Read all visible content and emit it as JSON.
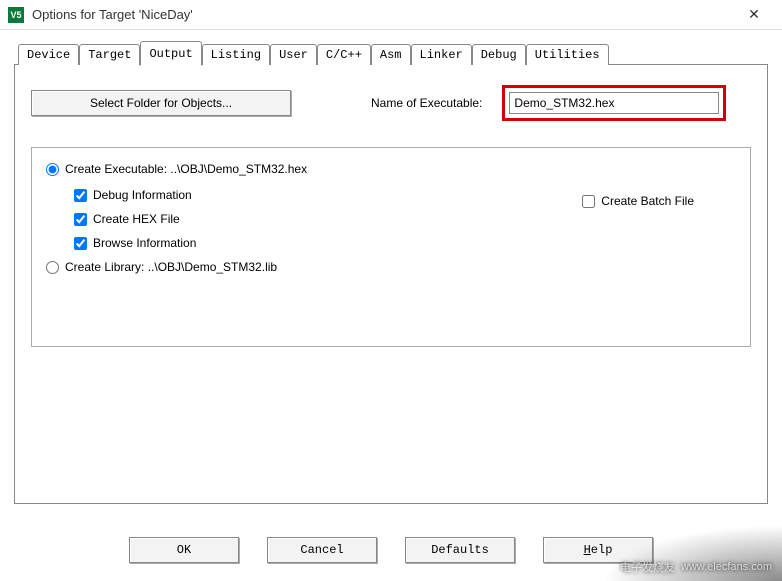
{
  "window": {
    "title": "Options for Target 'NiceDay'",
    "icon_label": "V5"
  },
  "tabs": [
    {
      "label": "Device"
    },
    {
      "label": "Target"
    },
    {
      "label": "Output",
      "active": true
    },
    {
      "label": "Listing"
    },
    {
      "label": "User"
    },
    {
      "label": "C/C++"
    },
    {
      "label": "Asm"
    },
    {
      "label": "Linker"
    },
    {
      "label": "Debug"
    },
    {
      "label": "Utilities"
    }
  ],
  "output": {
    "select_folder_btn": "Select Folder for Objects...",
    "exe_label": "Name of Executable:",
    "exe_value": "Demo_STM32.hex",
    "radio_exec": "Create Executable:  ..\\OBJ\\Demo_STM32.hex",
    "debug_info": "Debug Information",
    "debug_info_checked": true,
    "hex_file": "Create HEX File",
    "hex_file_checked": true,
    "browse_info": "Browse Information",
    "browse_info_checked": true,
    "radio_lib": "Create Library:  ..\\OBJ\\Demo_STM32.lib",
    "batch_file": "Create Batch File",
    "batch_file_checked": false,
    "radio_selected": "exec"
  },
  "buttons": {
    "ok": "OK",
    "cancel": "Cancel",
    "defaults": "Defaults",
    "help": "Help"
  },
  "watermark": {
    "text": "电子发烧友",
    "url": "www.elecfans.com"
  }
}
